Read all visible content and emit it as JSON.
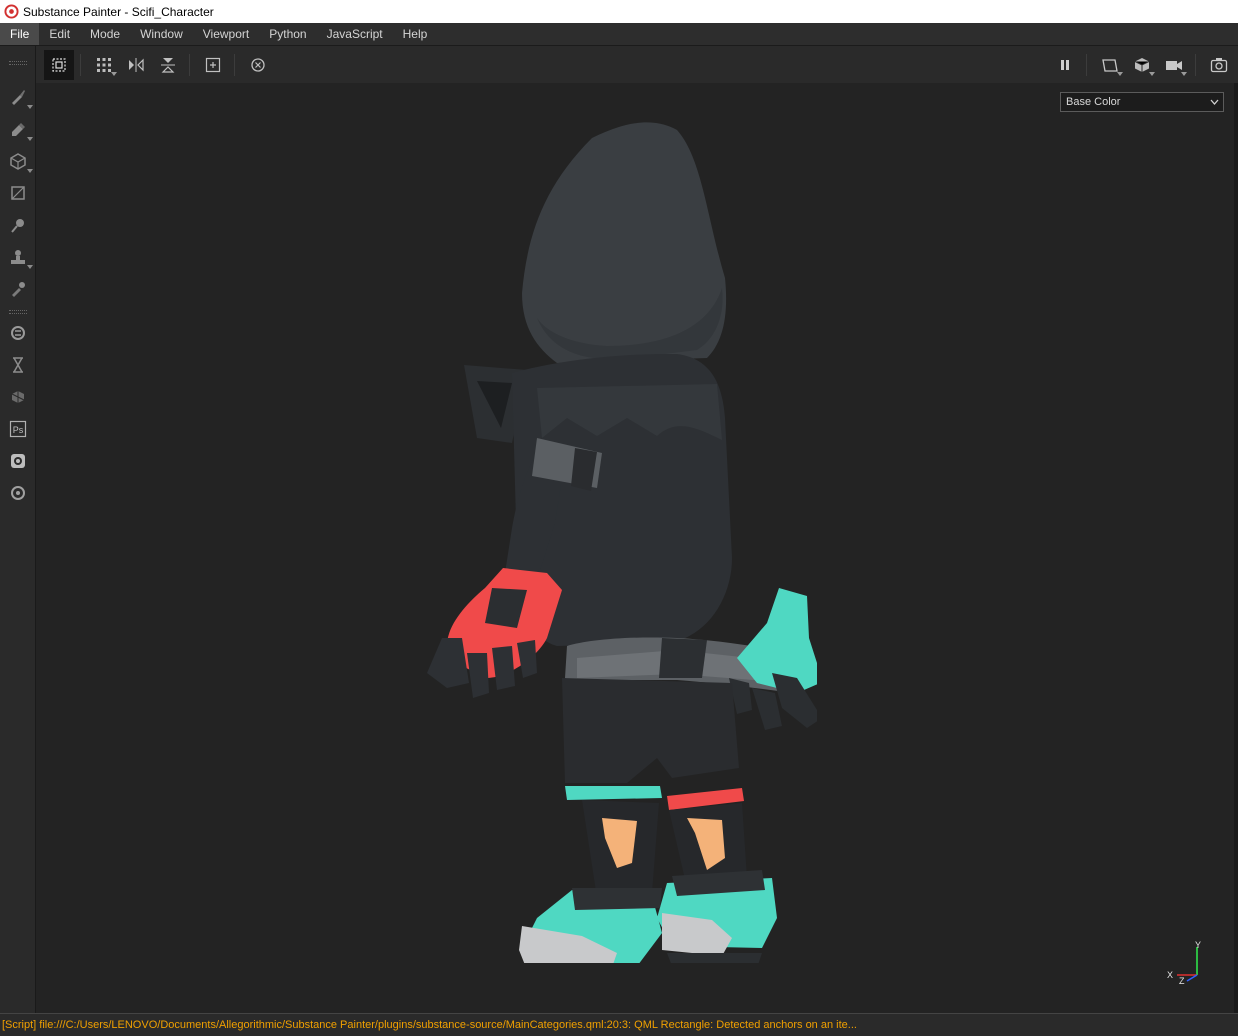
{
  "window": {
    "title": "Substance Painter - Scifi_Character"
  },
  "menubar": {
    "items": [
      {
        "label": "File",
        "active": true
      },
      {
        "label": "Edit"
      },
      {
        "label": "Mode"
      },
      {
        "label": "Window"
      },
      {
        "label": "Viewport"
      },
      {
        "label": "Python"
      },
      {
        "label": "JavaScript"
      },
      {
        "label": "Help"
      }
    ]
  },
  "toolbar": {
    "left_icons": [
      "selection-mode-icon",
      "grid-options-icon",
      "mirror-x-icon",
      "mirror-y-icon",
      "fit-to-view-icon",
      "history-icon"
    ],
    "right_icons": [
      "pause-icon",
      "display-mode-icon",
      "3d-cube-icon",
      "camera-icon",
      "screenshot-icon"
    ]
  },
  "tools": [
    "paint-brush-icon",
    "eraser-icon",
    "projection-icon",
    "polygon-fill-icon",
    "smudge-icon",
    "clone-stamp-icon",
    "color-picker-icon",
    "substance-source-icon",
    "timer-icon",
    "substance-share-icon",
    "photoshop-icon",
    "substance-bake-icon",
    "substance-logo-icon"
  ],
  "photoshop_label": "Ps",
  "viewport": {
    "channel": "Base Color",
    "gizmo": {
      "x": "X",
      "y": "Y",
      "z": "Z"
    }
  },
  "status": {
    "message": "[Script] file:///C:/Users/LENOVO/Documents/Allegorithmic/Substance Painter/plugins/substance-source/MainCategories.qml:20:3: QML Rectangle: Detected anchors on an ite..."
  },
  "colors": {
    "background": "#232323",
    "panel": "#2a2a2a",
    "status_text": "#f0a000",
    "glove_red": "#f04a4a",
    "glove_teal": "#4fd8c2",
    "cloth": "#2b2d30",
    "skin": "#f4b279"
  }
}
